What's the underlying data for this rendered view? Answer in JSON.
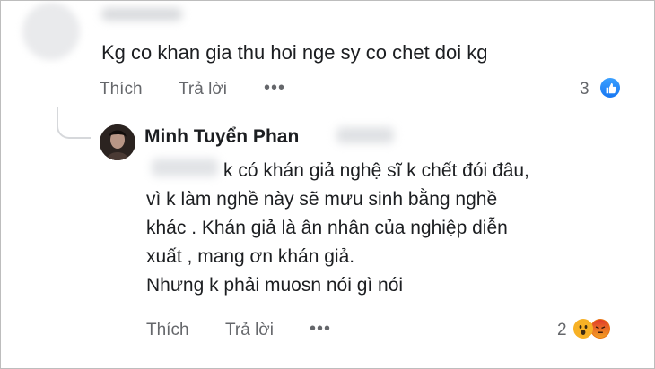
{
  "comment": {
    "text": "Kg co khan gia thu hoi nge sy co chet doi kg",
    "actions": {
      "like": "Thích",
      "reply": "Trả lời",
      "more": "•••"
    },
    "reaction_count": "3",
    "reaction_icons": [
      "like-icon"
    ]
  },
  "reply": {
    "author": "Minh Tuyển Phan",
    "lines": [
      "k có khán giả nghệ sĩ k chết đói đâu,",
      "vì k làm nghề này sẽ mưu sinh bằng nghề",
      "khác . Khán giả là ân nhân của nghiệp diễn",
      "xuất , mang ơn khán giả.",
      "Nhưng k phải muosn nói gì nói"
    ],
    "actions": {
      "like": "Thích",
      "reply": "Trả lời",
      "more": "•••"
    },
    "reaction_count": "2",
    "reaction_icons": [
      "wow-icon",
      "angry-icon"
    ]
  },
  "colors": {
    "text": "#1c1e21",
    "secondary": "#65676b",
    "like_blue": "#1877f2",
    "wow_yellow": "#f7b125",
    "angry_orange": "#e9710f"
  }
}
